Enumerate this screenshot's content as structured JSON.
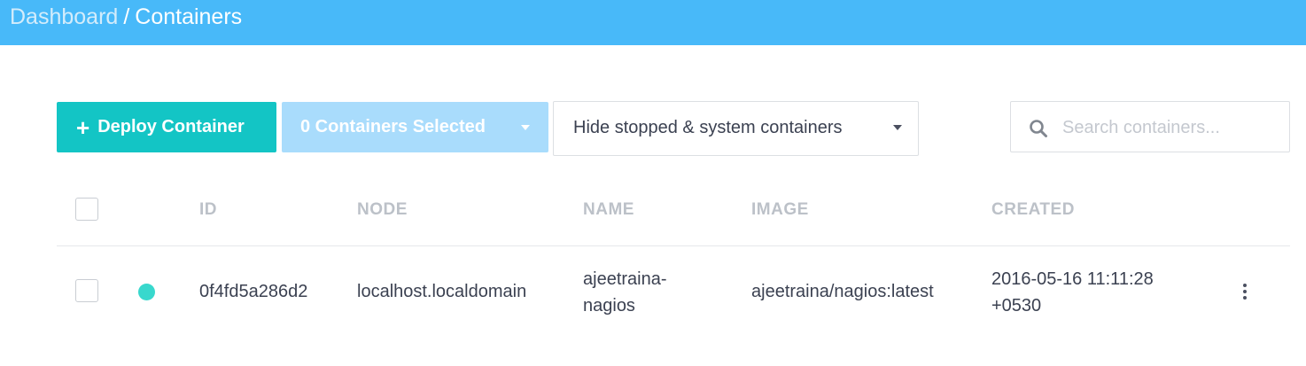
{
  "header": {
    "breadcrumb_root": "Dashboard",
    "breadcrumb_separator": "/",
    "breadcrumb_current": "Containers"
  },
  "toolbar": {
    "deploy_icon": "plus-icon",
    "deploy_label": "Deploy Container",
    "selected_label": "0 Containers Selected",
    "filter_label": "Hide stopped & system containers",
    "search_placeholder": "Search containers...",
    "search_value": ""
  },
  "table": {
    "columns": [
      "ID",
      "NODE",
      "NAME",
      "IMAGE",
      "CREATED"
    ],
    "rows": [
      {
        "status": "running",
        "id": "0f4fd5a286d2",
        "node": "localhost.localdomain",
        "name_line1": "ajeetraina-",
        "name_line2": "nagios",
        "image": "ajeetraina/nagios:latest",
        "created_line1": "2016-05-16 11:11:28",
        "created_line2": "+0530"
      }
    ]
  },
  "colors": {
    "header_bg": "#48b9f9",
    "deploy_button": "#13c5c5",
    "selected_button": "#a9dcfc",
    "status_running": "#38d8cd"
  }
}
